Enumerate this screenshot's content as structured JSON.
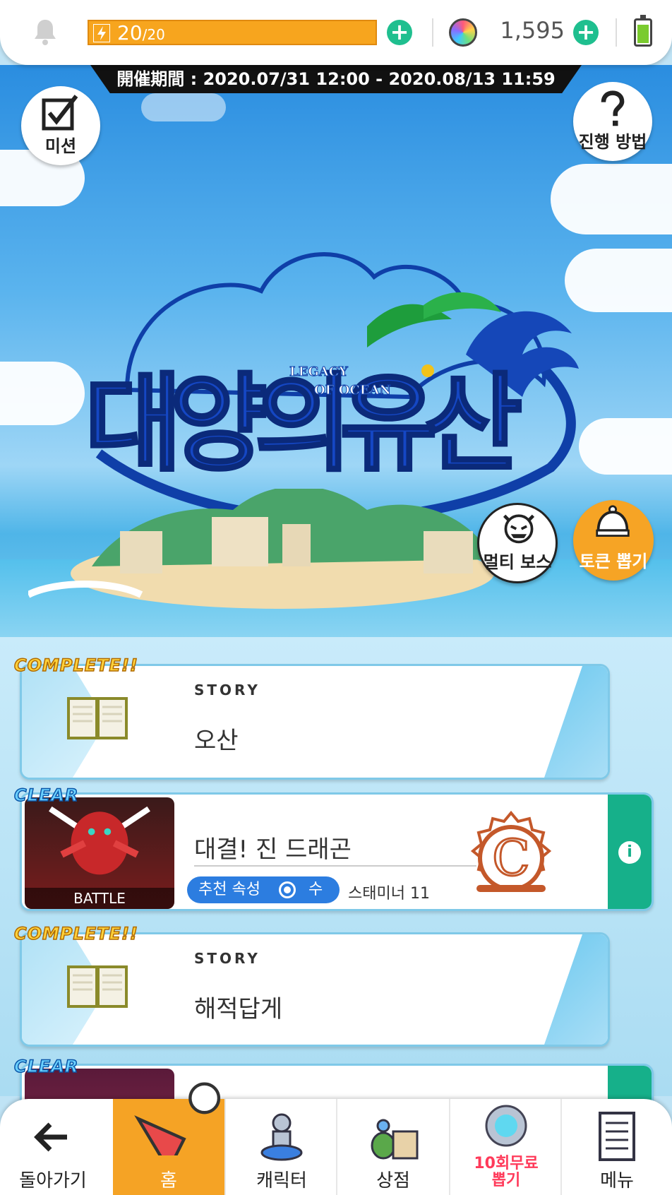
{
  "topbar": {
    "stamina_current": "20",
    "stamina_max": "/20",
    "gem_count": "1,595"
  },
  "event": {
    "period": "開催期間 : 2020.07/31 12:00 - 2020.08/13 11:59",
    "mission_label": "미션",
    "howto_label": "진행 방법",
    "logo_main": "대양의유산",
    "logo_sub_1": "LEGACY",
    "logo_sub_2": "OF OCEAN",
    "multi_boss_label": "멀티 보스",
    "token_draw_label": "토큰 뽑기"
  },
  "quests": [
    {
      "badge": "COMPLETE!!",
      "kicker": "STORY",
      "title": "오산"
    },
    {
      "badge": "CLEAR",
      "thumb_caption": "BATTLE",
      "title": "대결! 진 드래곤",
      "attr_key": "추천 속성",
      "attr_value": "수",
      "stamina": "스태미너 11",
      "rank": "C"
    },
    {
      "badge": "COMPLETE!!",
      "kicker": "STORY",
      "title": "해적답게"
    },
    {
      "badge": "CLEAR"
    }
  ],
  "nav": {
    "back": "돌아가기",
    "home": "홈",
    "character": "캐릭터",
    "shop": "상점",
    "gacha_line1": "10회무료",
    "gacha_line2": "뽑기",
    "menu": "메뉴"
  },
  "colors": {
    "stamina": "#f7a51e",
    "plus": "#1fbf8f",
    "nav_active": "#f5a325",
    "attr_pill": "#2c7de0",
    "info_tab": "#16b08a"
  }
}
